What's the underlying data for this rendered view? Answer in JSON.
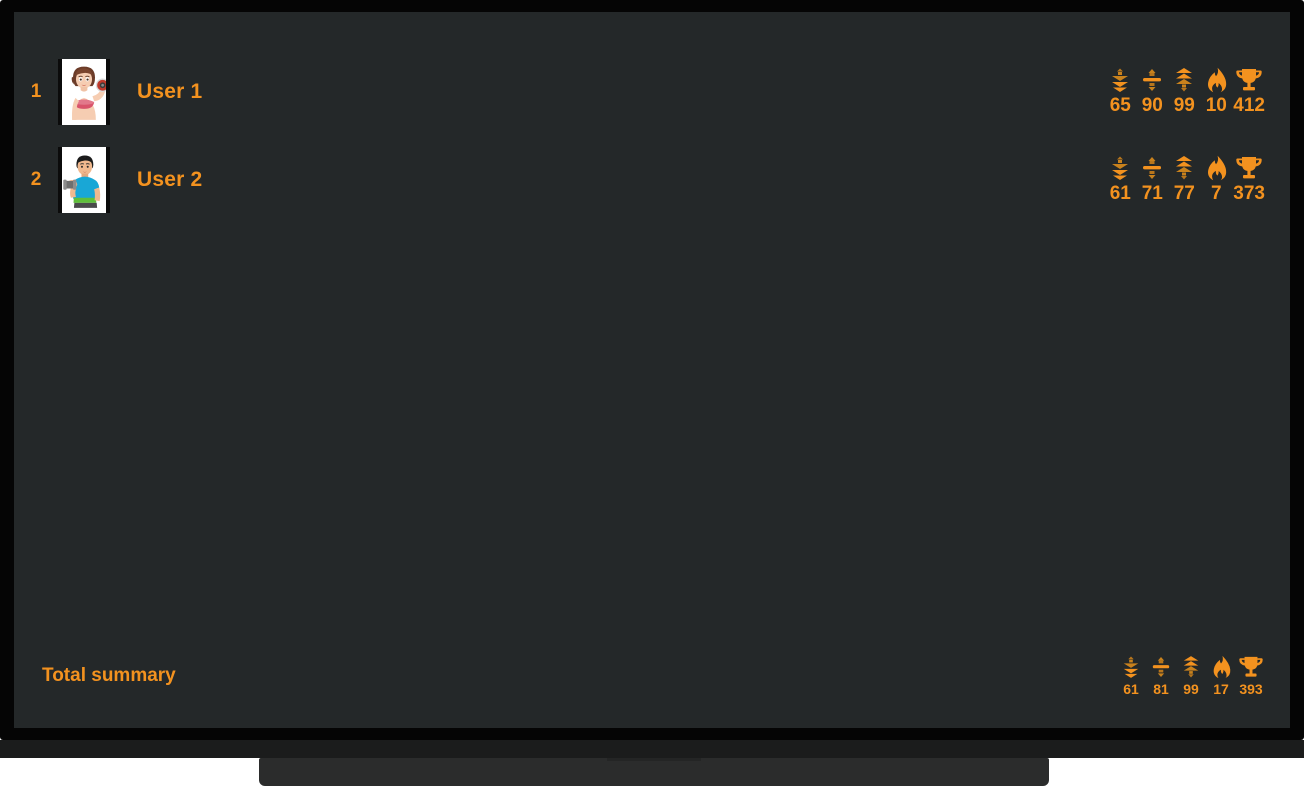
{
  "screen": {
    "background_color": "#242829",
    "accent_color": "#f3921f",
    "bezel_color": "#050505"
  },
  "stat_icons": [
    {
      "name": "min-chevrons-down-icon",
      "label": "minimum"
    },
    {
      "name": "average-divider-icon",
      "label": "average"
    },
    {
      "name": "max-chevrons-up-icon",
      "label": "maximum"
    },
    {
      "name": "flame-icon",
      "label": "streak"
    },
    {
      "name": "trophy-icon",
      "label": "score"
    }
  ],
  "leaderboard": {
    "rows": [
      {
        "rank": "1",
        "name": "User 1",
        "avatar": "female-athlete-avatar",
        "stats": [
          "65",
          "90",
          "99",
          "10",
          "412"
        ]
      },
      {
        "rank": "2",
        "name": "User 2",
        "avatar": "male-athlete-avatar",
        "stats": [
          "61",
          "71",
          "77",
          "7",
          "373"
        ]
      }
    ]
  },
  "totals": {
    "label": "Total summary",
    "stats": [
      "61",
      "81",
      "99",
      "17",
      "393"
    ]
  }
}
